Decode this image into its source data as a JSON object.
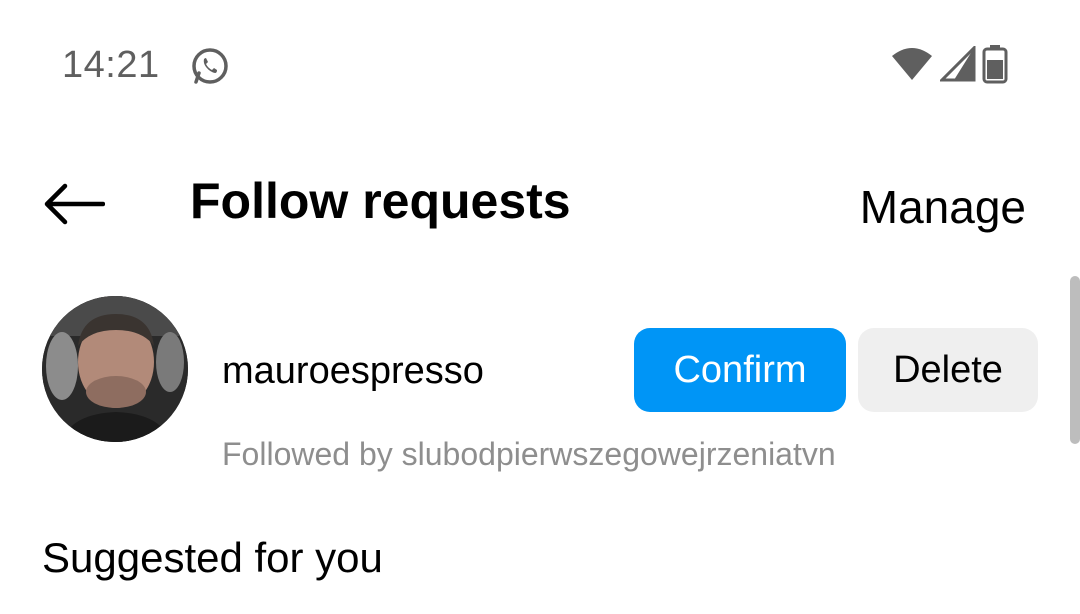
{
  "status_bar": {
    "time": "14:21",
    "app_icon": "whatsapp-icon",
    "icons": [
      "wifi-icon",
      "signal-icon",
      "battery-icon"
    ]
  },
  "header": {
    "back_icon": "back-arrow-icon",
    "title": "Follow requests",
    "manage_label": "Manage"
  },
  "requests": [
    {
      "username": "mauroespresso",
      "followed_by": "Followed by slubodpierwszegowejrzeniatvn",
      "confirm_label": "Confirm",
      "delete_label": "Delete"
    }
  ],
  "suggested": {
    "title": "Suggested for you"
  },
  "colors": {
    "accent": "#0095f6",
    "secondary_button": "#efefef",
    "muted_text": "#8e8e8e"
  }
}
